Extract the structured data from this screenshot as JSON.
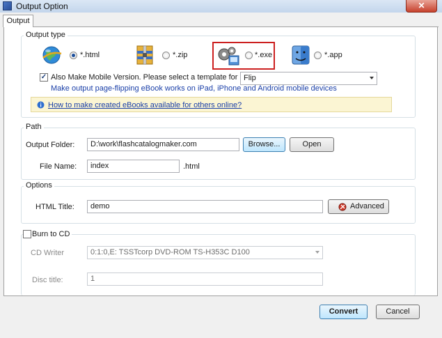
{
  "window": {
    "title": "Output Option",
    "close_glyph": "✕"
  },
  "tabs": [
    {
      "label": "Output"
    }
  ],
  "output_type": {
    "legend": "Output type",
    "options": [
      {
        "label": "*.html",
        "icon": "globe-icon",
        "selected": true
      },
      {
        "label": "*.zip",
        "icon": "zip-archive-icon",
        "selected": false
      },
      {
        "label": "*.exe",
        "icon": "gears-exe-icon",
        "selected": false,
        "highlighted": true
      },
      {
        "label": "*.app",
        "icon": "mac-finder-icon",
        "selected": false
      }
    ],
    "mobile_checkbox": {
      "label": "Also Make Mobile Version. Please select a template for mobile:",
      "checked": true
    },
    "mobile_template": {
      "selected": "Flip"
    },
    "mobile_hint": "Make output page-flipping eBook works on iPad, iPhone and Android mobile devices",
    "help_link": "How to make created eBooks available for others online?"
  },
  "path": {
    "legend": "Path",
    "output_folder_label": "Output Folder:",
    "output_folder_value": "D:\\work\\flashcatalogmaker.com",
    "browse_label": "Browse...",
    "open_label": "Open",
    "file_name_label": "File Name:",
    "file_name_value": "index",
    "file_ext": ".html"
  },
  "options": {
    "legend": "Options",
    "html_title_label": "HTML Title:",
    "html_title_value": "demo",
    "advanced_label": "Advanced"
  },
  "burn": {
    "label": "Burn to CD",
    "checked": false,
    "cd_writer_label": "CD Writer",
    "cd_writer_value": "0:1:0,E: TSSTcorp DVD-ROM TS-H353C D100",
    "disc_title_label": "Disc title:",
    "disc_title_value": "1"
  },
  "footer": {
    "convert_label": "Convert",
    "cancel_label": "Cancel"
  },
  "colors": {
    "highlight": "#cc1f1f",
    "link": "#1a3fa8",
    "hint_bg": "#fbf5d3",
    "hint_border": "#e5d89a"
  }
}
